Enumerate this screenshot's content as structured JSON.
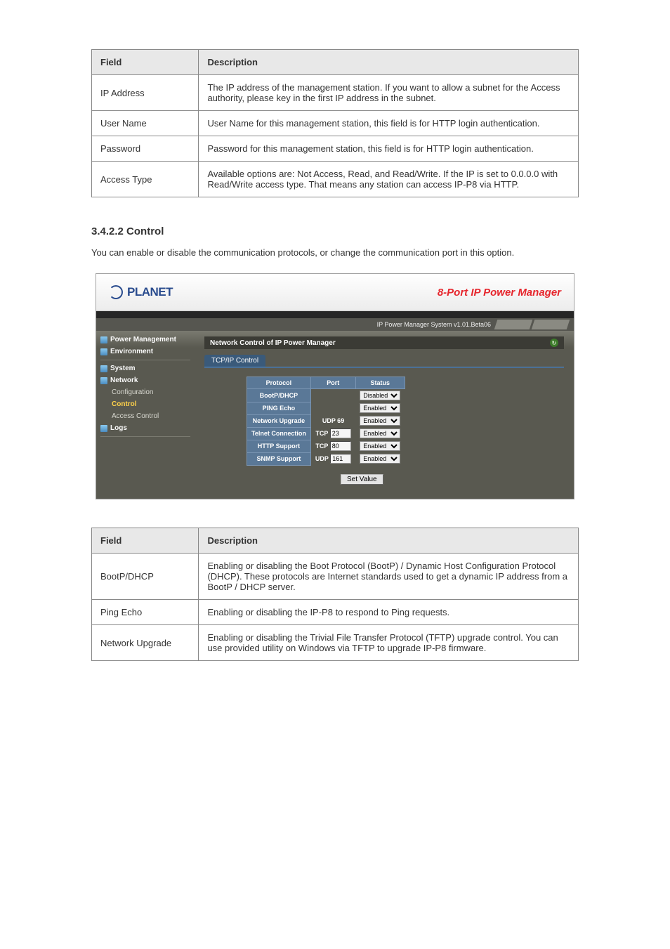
{
  "table1": {
    "h_field": "Field",
    "h_desc": "Description",
    "rows": [
      {
        "field": "IP Address",
        "desc": "The IP address of the management station. If you want to allow a subnet for the Access authority, please key in the first IP address in the subnet."
      },
      {
        "field": "User Name",
        "desc": "User Name for this management station, this field is for HTTP login authentication."
      },
      {
        "field": "Password",
        "desc": "Password for this management station, this field is for HTTP login authentication."
      },
      {
        "field": "Access Type",
        "desc": "Available options are: Not Access, Read, and Read/Write. If the IP is set to 0.0.0.0 with Read/Write access type. That means any station can access IP-P8 via HTTP."
      }
    ]
  },
  "section": {
    "heading": "3.4.2.2 Control",
    "text": "You can enable or disable the communication protocols, or change the communication port in this option."
  },
  "screenshot": {
    "logo": "PLANET",
    "header_title": "8-Port IP Power Manager",
    "status": "IP Power Manager System v1.01.Beta06",
    "nav": {
      "power": "Power Management",
      "env": "Environment",
      "system": "System",
      "network": "Network",
      "config": "Configuration",
      "control": "Control",
      "access": "Access Control",
      "logs": "Logs"
    },
    "panel_title": "Network Control of IP Power Manager",
    "tab": "TCP/IP Control",
    "th_protocol": "Protocol",
    "th_port": "Port",
    "th_status": "Status",
    "rows": [
      {
        "proto": "BootP/DHCP",
        "port": "",
        "status": "Disabled"
      },
      {
        "proto": "PING Echo",
        "port": "",
        "status": "Enabled"
      },
      {
        "proto": "Network Upgrade",
        "port": "UDP 69",
        "status": "Enabled"
      },
      {
        "proto": "Telnet Connection",
        "port_prefix": "TCP",
        "port_val": "23",
        "status": "Enabled"
      },
      {
        "proto": "HTTP Support",
        "port_prefix": "TCP",
        "port_val": "80",
        "status": "Enabled"
      },
      {
        "proto": "SNMP Support",
        "port_prefix": "UDP",
        "port_val": "161",
        "status": "Enabled"
      }
    ],
    "button": "Set Value"
  },
  "table2": {
    "h_field": "Field",
    "h_desc": "Description",
    "rows": [
      {
        "field": "BootP/DHCP",
        "desc": "Enabling or disabling the Boot Protocol (BootP) / Dynamic Host Configuration Protocol (DHCP). These protocols are Internet standards used to get a dynamic IP address from a BootP / DHCP server."
      },
      {
        "field": "Ping Echo",
        "desc": "Enabling or disabling the IP-P8 to respond to Ping requests."
      },
      {
        "field": "Network Upgrade",
        "desc": "Enabling or disabling the Trivial File Transfer Protocol (TFTP) upgrade control. You can use provided utility on Windows via TFTP to upgrade IP-P8 firmware."
      }
    ]
  }
}
